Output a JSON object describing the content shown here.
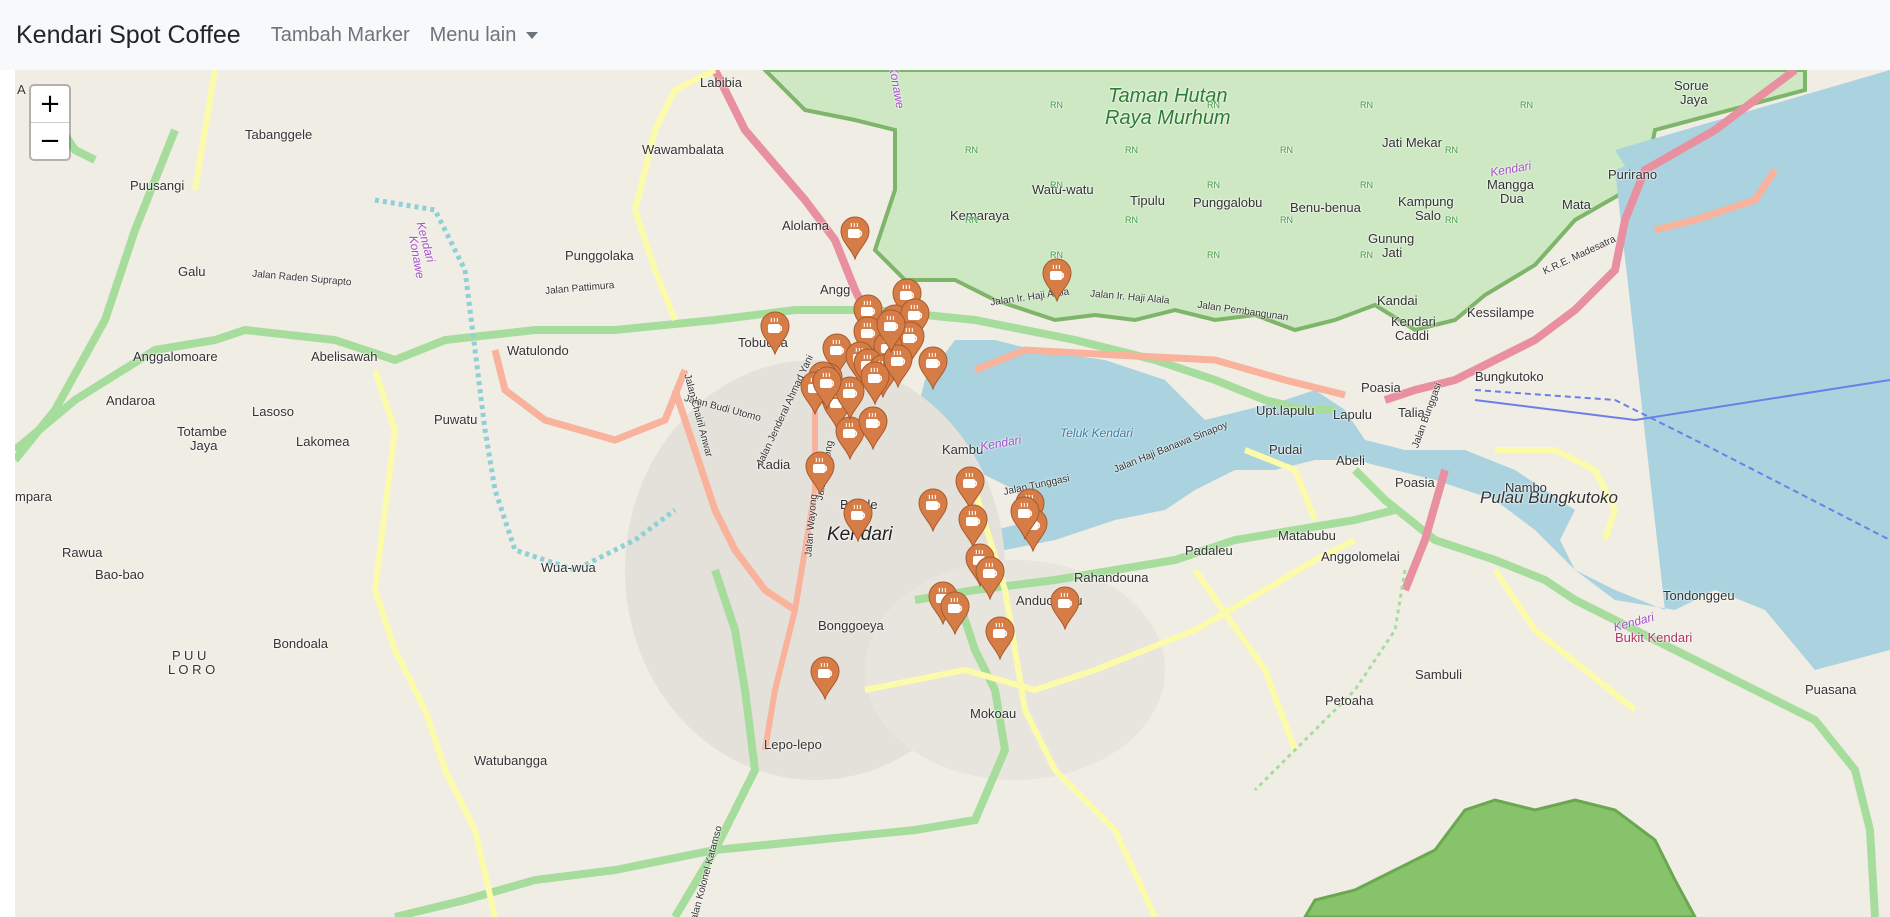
{
  "navbar": {
    "brand": "Kendari Spot Coffee",
    "links": [
      {
        "label": "Tambah Marker"
      },
      {
        "label": "Menu lain"
      }
    ]
  },
  "zoom": {
    "in": "+",
    "out": "−"
  },
  "map": {
    "labels": {
      "kendari": "Kendari",
      "taman": "Taman Hutan",
      "taman2": "Raya Murhum",
      "teluk": "Teluk Kendari",
      "bungkutoko": "Pulau Bungkutoko",
      "labibia": "Labibia",
      "tabanggele": "Tabanggele",
      "wawambalata": "Wawambalata",
      "puusangi": "Puusangi",
      "alolama": "Alolama",
      "punggolaka": "Punggolaka",
      "galu": "Galu",
      "anggalomoare": "Anggalomoare",
      "abelisawah": "Abelisawah",
      "watulondo": "Watulondo",
      "tobuuha": "Tobuuha",
      "andaroa": "Andaroa",
      "lasoso": "Lasoso",
      "puwatu": "Puwatu",
      "totambe": "Totambe",
      "jaya": "Jaya",
      "lakomea": "Lakomea",
      "kadia": "Kadia",
      "bende": "Bende",
      "rawua": "Rawua",
      "baobao": "Bao-bao",
      "wuawua": "Wua-wua",
      "bondoala": "Bondoala",
      "puuloro1": "P U U",
      "puuloro2": "L O R O",
      "bonggoeya": "Bonggoeya",
      "lepolepo": "Lepo-lepo",
      "watubangga": "Watubangga",
      "mokoau": "Mokoau",
      "anduonohu": "Anduonohu",
      "rahandouna": "Rahandouna",
      "padaleu": "Padaleu",
      "matabubu": "Matabubu",
      "anggolomelai": "Anggolomelai",
      "pudai": "Pudai",
      "abeli": "Abeli",
      "poasia": "Poasia",
      "poasia2": "Poasia",
      "lapulu": "Lapulu",
      "talia": "Talia",
      "uptlapulu": "Upt.lapulu",
      "bungkutoko_v": "Bungkutoko",
      "nambo": "Nambo",
      "tondonggeu": "Tondonggeu",
      "bukitkendari": "Bukit Kendari",
      "sambuli": "Sambuli",
      "petoaha": "Petoaha",
      "puasana": "Puasana",
      "kemaraya": "Kemaraya",
      "watuwatu": "Watu-watu",
      "tipulu": "Tipulu",
      "punggalobu": "Punggalobu",
      "benubenua": "Benu-benua",
      "kampungsalo1": "Kampung",
      "kampungsalo2": "Salo",
      "gunungjati1": "Gunung",
      "gunungjati2": "Jati",
      "jatimekar": "Jati Mekar",
      "manggadua1": "Mangga",
      "manggadua2": "Dua",
      "mata": "Mata",
      "purirano": "Purirano",
      "sorue1": "Sorue",
      "sorue2": "Jaya",
      "kandai": "Kandai",
      "kendaricaddi1": "Kendari",
      "kendaricaddi2": "Caddi",
      "kessilampe": "Kessilampe",
      "mpara": "mpara",
      "a": "A",
      "kambu": "Kambu",
      "angg": "Angg",
      "jl_raden": "Jalan Raden Suprapto",
      "jl_pattimura": "Jalan Pattimura",
      "jl_hajialala": "Jalan Ir. Haji Alala",
      "jl_hajialala2": "Jalan Ir. Haji Alala",
      "jl_pembangunan": "Jalan Pembangunan",
      "jl_budi": "Jalan Budi Utomo",
      "jl_chairil": "Jalan Chairil Anwar",
      "jl_ahmadyani": "Jalan Jenderal Ahmad Yani",
      "jl_wayong": "Jalan Wayong",
      "jl_wolong": "Jalan Wolong",
      "jl_sinapoy": "Jalan Haji Banawa Sinapoy",
      "jl_tunggasi": "Jalan Tunggasi",
      "jl_kessilampe": "Jalan Bunggasi",
      "jl_madesatra": "K.R.E. Madesatra",
      "jl_katamso": "Jalan Kolonel Katamso",
      "river_kendari": "Kendari",
      "river_konawe": "Konawe",
      "river_kendari2": "Kendari",
      "river_kendari3": "Kendari",
      "river_kendari4": "Kendari",
      "river_konawe2": "Konawe",
      "rn": "RN"
    },
    "marker_icon": "coffee-cup-icon",
    "marker_color": "#d67d47",
    "marker_count": 42
  },
  "colors": {
    "water": "#aad3df",
    "park": "#c8facc",
    "forest": "#add19e",
    "primary_road": "#a7dd9c",
    "trunk_road": "#e990a0",
    "secondary_road": "#f9b29c",
    "tertiary_road": "#fcfbaa",
    "land": "#f0ede5"
  }
}
